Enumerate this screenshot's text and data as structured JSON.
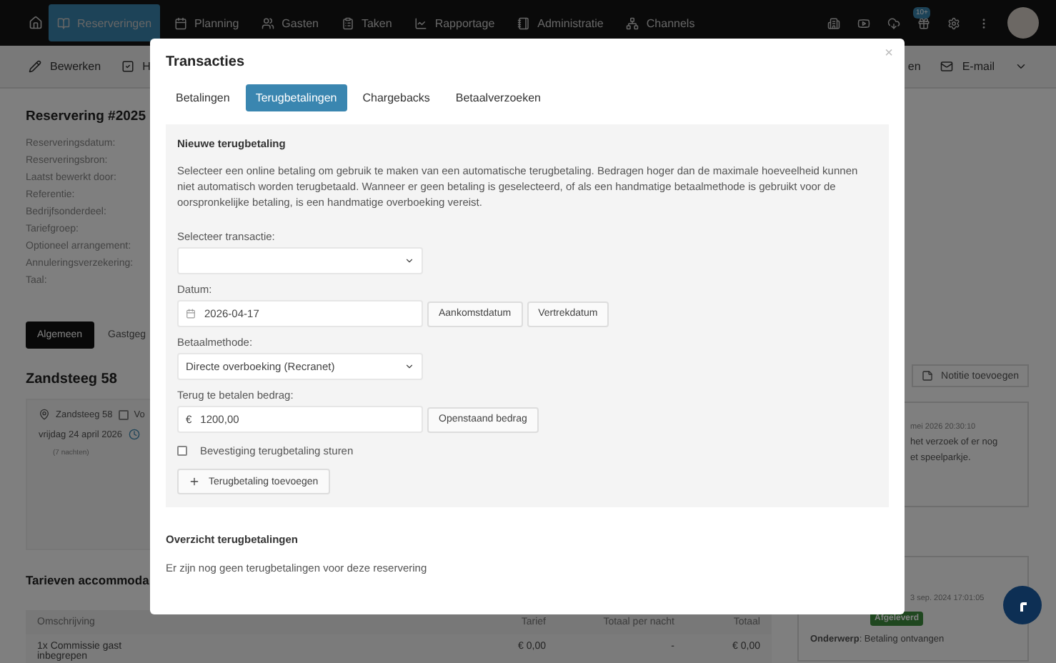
{
  "nav": {
    "items": [
      {
        "label": "Reserveringen",
        "selected": true
      },
      {
        "label": "Planning",
        "selected": false
      },
      {
        "label": "Gasten",
        "selected": false
      },
      {
        "label": "Taken",
        "selected": false
      },
      {
        "label": "Rapportage",
        "selected": false
      },
      {
        "label": "Administratie",
        "selected": false
      },
      {
        "label": "Channels",
        "selected": false
      }
    ],
    "badge": "10+"
  },
  "toolbar": {
    "left": [
      {
        "label": "Bewerken"
      },
      {
        "label": "H"
      }
    ],
    "right": [
      {
        "label": "en"
      },
      {
        "label": "E-mail"
      }
    ]
  },
  "reservation": {
    "title": "Reservering #2025",
    "fields": [
      "Reserveringsdatum:",
      "Reserveringsbron:",
      "Laatst bewerkt door:",
      "Referentie:",
      "Bedrijfsonderdeel:",
      "Tariefgroep:",
      "Optioneel arrangement:",
      "Annuleringsverzekering:",
      "Taal:"
    ],
    "tabs": [
      {
        "label": "Algemeen",
        "selected": true
      },
      {
        "label": "Gastgeg",
        "selected": false
      }
    ],
    "unit_title": "Zandsteeg 58",
    "unit_card": {
      "location": "Zandsteeg 58",
      "checkbox_label": "Vo",
      "checked": false,
      "date": "vrijdag 24 april 2026",
      "nights": "(7 nachten)"
    }
  },
  "rates": {
    "title": "Tarieven accommoda",
    "columns": [
      "Omschrijving",
      "Tarief",
      "Totaal per nacht",
      "Totaal"
    ],
    "rows": [
      {
        "cells": [
          "1x Commissie gast",
          "€ 0,00",
          "-",
          "€ 0,00"
        ],
        "note": "inbegrepen"
      }
    ]
  },
  "notes": {
    "button": "Notitie toevoegen",
    "cards": [
      {
        "time": "mei 2026 20:30:10",
        "lines": [
          "het verzoek of er nog",
          "et speelparkje."
        ]
      },
      {
        "time": "3 sep. 2024 17:01:05",
        "status": "Afgeleverd",
        "lines": [
          "**Onderwerp**: Betaling ontvangen"
        ]
      }
    ]
  },
  "modal": {
    "title": "Transacties",
    "close": "×",
    "tabs": [
      {
        "label": "Betalingen",
        "selected": false
      },
      {
        "label": "Terugbetalingen",
        "selected": true
      },
      {
        "label": "Chargebacks",
        "selected": false
      },
      {
        "label": "Betaalverzoeken",
        "selected": false
      }
    ],
    "panel": {
      "title": "Nieuwe terugbetaling",
      "intro": "Selecteer een online betaling om gebruik te maken van een automatische terugbetaling. Bedragen hoger dan de maximale hoeveelheid kunnen niet automatisch worden terugbetaald. Wanneer er geen betaling is geselecteerd, of als een handmatige betaalmethode is gebruikt voor de oorspronkelijke betaling, is een handmatige overboeking vereist.",
      "transaction": {
        "label": "Selecteer transactie:"
      },
      "date": {
        "label": "Datum:",
        "value": "2026-04-17",
        "buttons": [
          "Aankomstdatum",
          "Vertrekdatum"
        ]
      },
      "method": {
        "label": "Betaalmethode:",
        "value": "Directe overboeking (Recranet)"
      },
      "amount": {
        "label": "Terug te betalen bedrag:",
        "prefix": "€",
        "value": "1200,00",
        "button": "Openstaand bedrag"
      },
      "confirm": {
        "label": "Bevestiging terugbetaling sturen",
        "checked": false
      },
      "submit": "Terugbetaling toevoegen"
    },
    "overview": {
      "title": "Overzicht terugbetalingen",
      "empty": "Er zijn nog geen terugbetalingen voor deze reservering"
    }
  }
}
